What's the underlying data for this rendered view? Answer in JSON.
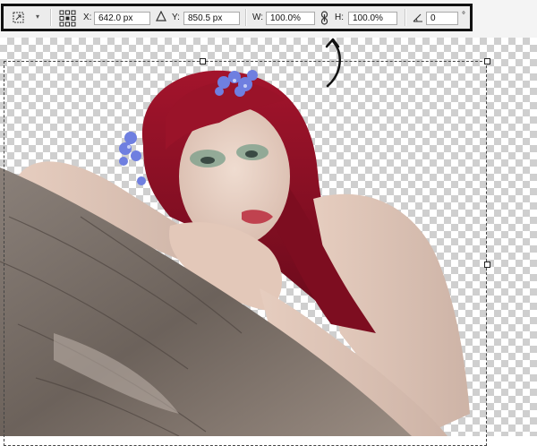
{
  "options_bar": {
    "tool": {
      "icon": "free-transform-icon",
      "caret": "▾"
    },
    "reference_point_icon": "reference-point-grid-icon",
    "x": {
      "label": "X:",
      "value": "642.0 px"
    },
    "delta_icon": "relative-position-delta-icon",
    "y": {
      "label": "Y:",
      "value": "850.5 px"
    },
    "w": {
      "label": "W:",
      "value": "100.0%"
    },
    "link_icon": "link-chain-icon",
    "h": {
      "label": "H:",
      "value": "100.0%"
    },
    "angle_icon": "rotate-angle-icon",
    "angle": {
      "value": "0",
      "unit": "°"
    }
  },
  "annotation": {
    "icon": "curved-arrow-icon"
  },
  "canvas": {
    "background": "transparency-checkerboard",
    "image": "woman with red hair and blue flowers resting arms on tree trunk"
  },
  "colors": {
    "hair": "#8c1024",
    "flowers": "#6f7fe0",
    "skin": "#e9d2c4",
    "bark": "#7a6f66",
    "frame": "#111111"
  }
}
